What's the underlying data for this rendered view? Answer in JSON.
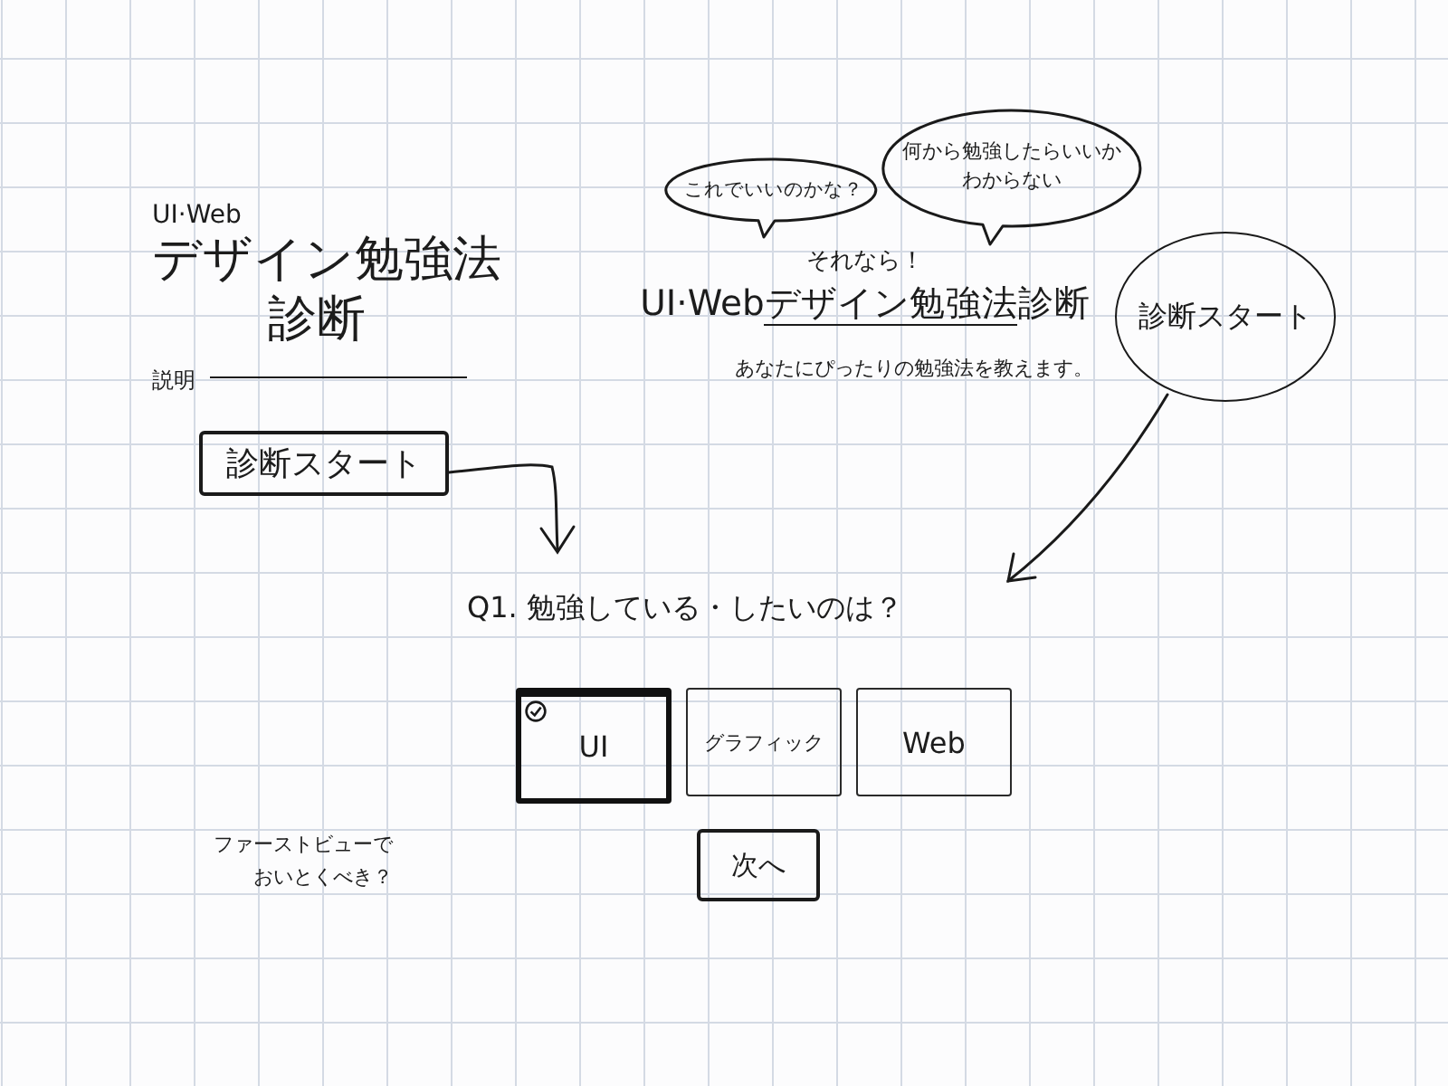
{
  "title_block": {
    "eyebrow": "UI·Web",
    "title": "デザイン勉強法",
    "subtitle": "診断",
    "description_label": "説明",
    "start_button": "診断スタート"
  },
  "bubbles": [
    {
      "text": "これでいいのかな？"
    },
    {
      "text": "何から勉強したらいいかわからない"
    }
  ],
  "hero": {
    "lead": "それなら！",
    "title_parts": [
      {
        "text": "UI·Web",
        "underlined": false
      },
      {
        "text": "デザイン勉強法",
        "underlined": true
      },
      {
        "text": "診断",
        "underlined": false
      }
    ],
    "description": "あなたにぴったりの勉強法を教えます。"
  },
  "start_circle": {
    "label": "診断スタート"
  },
  "question": {
    "title": "Q1. 勉強している・したいのは？",
    "options": [
      {
        "label": "UI",
        "selected": true
      },
      {
        "label": "グラフィック",
        "selected": false
      },
      {
        "label": "Web",
        "selected": false
      }
    ],
    "next_button": "次へ"
  },
  "note": "ファーストビューでおいとくべき？"
}
